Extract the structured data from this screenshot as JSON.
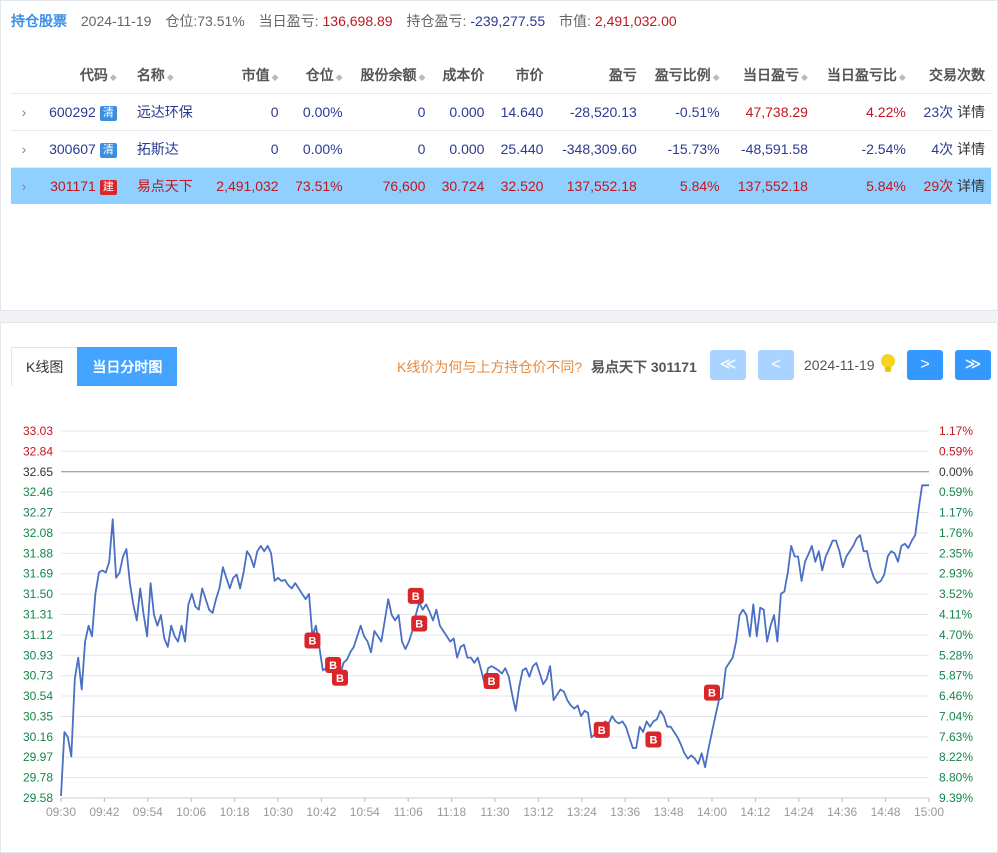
{
  "summary": {
    "title": "持仓股票",
    "date": "2024-11-19",
    "position_label": "仓位:",
    "position_value": "73.51%",
    "day_pnl_label": "当日盈亏:",
    "day_pnl_value": "136,698.89",
    "hold_pnl_label": "持仓盈亏:",
    "hold_pnl_value": "-239,277.55",
    "market_value_label": "市值:",
    "market_value_value": "2,491,032.00"
  },
  "table": {
    "headers": [
      "代码",
      "名称",
      "市值",
      "仓位",
      "股份余额",
      "成本价",
      "市价",
      "盈亏",
      "盈亏比例",
      "当日盈亏",
      "当日盈亏比",
      "交易次数"
    ],
    "sortable": [
      true,
      true,
      true,
      true,
      true,
      false,
      false,
      false,
      true,
      true,
      true,
      false
    ],
    "rows": [
      {
        "expand": "›",
        "code": "600292",
        "tag": "清",
        "tag_type": "qing",
        "name": "远达环保",
        "market_value": "0",
        "position": "0.00%",
        "shares": "0",
        "cost": "0.000",
        "price": "14.640",
        "pnl": "-28,520.13",
        "pnl_ratio": "-0.51%",
        "day_pnl": "47,738.29",
        "day_pnl_ratio": "4.22%",
        "trades": "23次",
        "detail": "详情",
        "highlight": false
      },
      {
        "expand": "›",
        "code": "300607",
        "tag": "清",
        "tag_type": "qing",
        "name": "拓斯达",
        "market_value": "0",
        "position": "0.00%",
        "shares": "0",
        "cost": "0.000",
        "price": "25.440",
        "pnl": "-348,309.60",
        "pnl_ratio": "-15.73%",
        "day_pnl": "-48,591.58",
        "day_pnl_ratio": "-2.54%",
        "trades": "4次",
        "detail": "详情",
        "highlight": false
      },
      {
        "expand": "›",
        "code": "301171",
        "tag": "建",
        "tag_type": "jian",
        "name": "易点天下",
        "market_value": "2,491,032",
        "position": "73.51%",
        "shares": "76,600",
        "cost": "30.724",
        "price": "32.520",
        "pnl": "137,552.18",
        "pnl_ratio": "5.84%",
        "day_pnl": "137,552.18",
        "day_pnl_ratio": "5.84%",
        "trades": "29次",
        "detail": "详情",
        "highlight": true
      }
    ]
  },
  "chart_panel": {
    "tabs": [
      "K线图",
      "当日分时图"
    ],
    "active_tab": 1,
    "hint": "K线价为何与上方持仓价不同?",
    "stock": "易点天下 301171",
    "date": "2024-11-19",
    "nav_first": "≪",
    "nav_prev": "<",
    "nav_next": ">",
    "nav_last": "≫"
  },
  "colors": {
    "line": "#4a6fc4",
    "up": "#c0171f",
    "down": "#13864a",
    "accent": "#44a3ff",
    "buy_marker": "#d9262b"
  },
  "chart_data": {
    "type": "line",
    "prev_close": 32.65,
    "y_ticks_price": [
      "33.03",
      "32.84",
      "32.65",
      "32.46",
      "32.27",
      "32.08",
      "31.88",
      "31.69",
      "31.50",
      "31.31",
      "31.12",
      "30.93",
      "30.73",
      "30.54",
      "30.35",
      "30.16",
      "29.97",
      "29.78",
      "29.58"
    ],
    "y_ticks_pct": [
      "1.17%",
      "0.59%",
      "0.00%",
      "0.59%",
      "1.17%",
      "1.76%",
      "2.35%",
      "2.93%",
      "3.52%",
      "4.11%",
      "4.70%",
      "5.28%",
      "5.87%",
      "6.46%",
      "7.04%",
      "7.63%",
      "8.22%",
      "8.80%",
      "9.39%"
    ],
    "ylim": [
      29.58,
      33.03
    ],
    "x_ticks": [
      "09:30",
      "09:42",
      "09:54",
      "10:06",
      "10:18",
      "10:30",
      "10:42",
      "10:54",
      "11:06",
      "11:18",
      "11:30",
      "13:12",
      "13:24",
      "13:36",
      "13:48",
      "14:00",
      "14:12",
      "14:24",
      "14:36",
      "14:48",
      "15:00"
    ],
    "series": [
      {
        "points": [
          [
            0,
            29.6
          ],
          [
            1,
            30.2
          ],
          [
            2,
            30.15
          ],
          [
            3,
            29.97
          ],
          [
            4,
            30.7
          ],
          [
            5,
            30.9
          ],
          [
            6,
            30.6
          ],
          [
            7,
            31.05
          ],
          [
            8,
            31.2
          ],
          [
            9,
            31.1
          ],
          [
            10,
            31.5
          ],
          [
            11,
            31.7
          ],
          [
            12,
            31.72
          ],
          [
            13,
            31.7
          ],
          [
            14,
            31.8
          ],
          [
            15,
            32.2
          ],
          [
            16,
            31.65
          ],
          [
            17,
            31.7
          ],
          [
            18,
            31.85
          ],
          [
            19,
            31.92
          ],
          [
            20,
            31.6
          ],
          [
            21,
            31.4
          ],
          [
            22,
            31.25
          ],
          [
            23,
            31.55
          ],
          [
            24,
            31.3
          ],
          [
            25,
            31.1
          ],
          [
            26,
            31.6
          ],
          [
            27,
            31.3
          ],
          [
            28,
            31.2
          ],
          [
            29,
            31.3
          ],
          [
            30,
            31.08
          ],
          [
            31,
            31.0
          ],
          [
            32,
            31.2
          ],
          [
            33,
            31.1
          ],
          [
            34,
            31.05
          ],
          [
            35,
            31.2
          ],
          [
            36,
            31.05
          ],
          [
            37,
            31.4
          ],
          [
            38,
            31.5
          ],
          [
            39,
            31.38
          ],
          [
            40,
            31.35
          ],
          [
            41,
            31.55
          ],
          [
            42,
            31.45
          ],
          [
            43,
            31.35
          ],
          [
            44,
            31.32
          ],
          [
            45,
            31.45
          ],
          [
            46,
            31.55
          ],
          [
            47,
            31.75
          ],
          [
            48,
            31.65
          ],
          [
            49,
            31.55
          ],
          [
            50,
            31.65
          ],
          [
            51,
            31.68
          ],
          [
            52,
            31.55
          ],
          [
            53,
            31.7
          ],
          [
            54,
            31.9
          ],
          [
            55,
            31.85
          ],
          [
            56,
            31.75
          ],
          [
            57,
            31.9
          ],
          [
            58,
            31.95
          ],
          [
            59,
            31.9
          ],
          [
            60,
            31.95
          ],
          [
            61,
            31.88
          ],
          [
            62,
            31.62
          ],
          [
            63,
            31.65
          ],
          [
            64,
            31.62
          ],
          [
            65,
            31.63
          ],
          [
            66,
            31.58
          ],
          [
            67,
            31.55
          ],
          [
            68,
            31.6
          ],
          [
            69,
            31.55
          ],
          [
            70,
            31.5
          ],
          [
            71,
            31.45
          ],
          [
            72,
            31.5
          ],
          [
            73,
            31.1
          ],
          [
            74,
            31.2
          ],
          [
            75,
            31.0
          ],
          [
            76,
            30.78
          ],
          [
            77,
            30.8
          ],
          [
            78,
            30.9
          ],
          [
            79,
            30.75
          ],
          [
            80,
            30.78
          ],
          [
            81,
            30.72
          ],
          [
            82,
            30.85
          ],
          [
            83,
            30.88
          ],
          [
            84,
            30.95
          ],
          [
            85,
            31.0
          ],
          [
            86,
            31.1
          ],
          [
            87,
            31.2
          ],
          [
            88,
            31.1
          ],
          [
            89,
            31.05
          ],
          [
            90,
            30.95
          ],
          [
            91,
            31.15
          ],
          [
            92,
            31.1
          ],
          [
            93,
            31.05
          ],
          [
            94,
            31.25
          ],
          [
            95,
            31.45
          ],
          [
            96,
            31.3
          ],
          [
            97,
            31.25
          ],
          [
            98,
            31.3
          ],
          [
            99,
            31.05
          ],
          [
            100,
            30.98
          ],
          [
            101,
            31.05
          ],
          [
            102,
            31.15
          ],
          [
            103,
            31.3
          ],
          [
            104,
            31.42
          ],
          [
            105,
            31.35
          ],
          [
            106,
            31.4
          ],
          [
            107,
            31.33
          ],
          [
            108,
            31.25
          ],
          [
            109,
            31.35
          ],
          [
            110,
            31.2
          ],
          [
            111,
            31.15
          ],
          [
            112,
            31.1
          ],
          [
            113,
            31.05
          ],
          [
            114,
            31.08
          ],
          [
            115,
            30.9
          ],
          [
            116,
            31.0
          ],
          [
            117,
            31.02
          ],
          [
            118,
            30.9
          ],
          [
            119,
            30.9
          ],
          [
            120,
            30.85
          ],
          [
            121,
            30.9
          ],
          [
            122,
            30.78
          ],
          [
            123,
            30.65
          ],
          [
            124,
            30.8
          ],
          [
            125,
            30.82
          ],
          [
            126,
            30.8
          ],
          [
            127,
            30.78
          ],
          [
            128,
            30.75
          ],
          [
            129,
            30.8
          ],
          [
            130,
            30.72
          ],
          [
            131,
            30.55
          ],
          [
            132,
            30.4
          ],
          [
            133,
            30.62
          ],
          [
            134,
            30.78
          ],
          [
            135,
            30.8
          ],
          [
            136,
            30.72
          ],
          [
            137,
            30.82
          ],
          [
            138,
            30.85
          ],
          [
            139,
            30.75
          ],
          [
            140,
            30.65
          ],
          [
            141,
            30.7
          ],
          [
            142,
            30.82
          ],
          [
            143,
            30.5
          ],
          [
            144,
            30.55
          ],
          [
            145,
            30.6
          ],
          [
            146,
            30.58
          ],
          [
            147,
            30.5
          ],
          [
            148,
            30.45
          ],
          [
            149,
            30.42
          ],
          [
            150,
            30.45
          ],
          [
            151,
            30.35
          ],
          [
            152,
            30.4
          ],
          [
            153,
            30.38
          ],
          [
            154,
            30.15
          ],
          [
            155,
            30.18
          ],
          [
            156,
            30.25
          ],
          [
            157,
            30.25
          ],
          [
            158,
            30.3
          ],
          [
            159,
            30.28
          ],
          [
            160,
            30.35
          ],
          [
            161,
            30.3
          ],
          [
            162,
            30.28
          ],
          [
            163,
            30.3
          ],
          [
            164,
            30.25
          ],
          [
            165,
            30.15
          ],
          [
            166,
            30.05
          ],
          [
            167,
            30.05
          ],
          [
            168,
            30.25
          ],
          [
            169,
            30.2
          ],
          [
            170,
            30.3
          ],
          [
            171,
            30.25
          ],
          [
            172,
            30.3
          ],
          [
            173,
            30.32
          ],
          [
            174,
            30.4
          ],
          [
            175,
            30.35
          ],
          [
            176,
            30.25
          ],
          [
            177,
            30.25
          ],
          [
            178,
            30.2
          ],
          [
            179,
            30.15
          ],
          [
            180,
            30.08
          ],
          [
            181,
            30.0
          ],
          [
            182,
            29.95
          ],
          [
            183,
            29.98
          ],
          [
            184,
            29.95
          ],
          [
            185,
            29.9
          ],
          [
            186,
            30.0
          ],
          [
            187,
            29.87
          ],
          [
            188,
            30.05
          ],
          [
            189,
            30.2
          ],
          [
            190,
            30.35
          ],
          [
            191,
            30.5
          ],
          [
            192,
            30.52
          ],
          [
            193,
            30.8
          ],
          [
            194,
            30.85
          ],
          [
            195,
            30.9
          ],
          [
            196,
            31.05
          ],
          [
            197,
            31.3
          ],
          [
            198,
            31.35
          ],
          [
            199,
            31.3
          ],
          [
            200,
            31.1
          ],
          [
            201,
            31.4
          ],
          [
            202,
            31.1
          ],
          [
            203,
            31.37
          ],
          [
            204,
            31.35
          ],
          [
            205,
            31.05
          ],
          [
            206,
            31.2
          ],
          [
            207,
            31.3
          ],
          [
            208,
            31.05
          ],
          [
            209,
            31.5
          ],
          [
            210,
            31.52
          ],
          [
            211,
            31.7
          ],
          [
            212,
            31.95
          ],
          [
            213,
            31.85
          ],
          [
            214,
            31.85
          ],
          [
            215,
            31.62
          ],
          [
            216,
            31.8
          ],
          [
            217,
            31.87
          ],
          [
            218,
            31.95
          ],
          [
            219,
            31.8
          ],
          [
            220,
            31.9
          ],
          [
            221,
            31.72
          ],
          [
            222,
            31.85
          ],
          [
            223,
            31.92
          ],
          [
            224,
            32.0
          ],
          [
            225,
            32.0
          ],
          [
            226,
            31.9
          ],
          [
            227,
            31.75
          ],
          [
            228,
            31.85
          ],
          [
            229,
            31.9
          ],
          [
            230,
            31.95
          ],
          [
            231,
            32.02
          ],
          [
            232,
            32.05
          ],
          [
            233,
            31.9
          ],
          [
            234,
            31.9
          ],
          [
            235,
            31.75
          ],
          [
            236,
            31.65
          ],
          [
            237,
            31.6
          ],
          [
            238,
            31.62
          ],
          [
            239,
            31.68
          ],
          [
            240,
            31.85
          ],
          [
            241,
            31.9
          ],
          [
            242,
            31.88
          ],
          [
            243,
            31.8
          ],
          [
            244,
            31.95
          ],
          [
            245,
            31.97
          ],
          [
            246,
            31.93
          ],
          [
            247,
            32.0
          ],
          [
            248,
            32.05
          ],
          [
            249,
            32.3
          ],
          [
            250,
            32.52
          ],
          [
            251,
            32.52
          ],
          [
            252,
            32.52
          ]
        ]
      }
    ],
    "buy_markers": [
      {
        "t": 73,
        "price": 31.06,
        "label": "B"
      },
      {
        "t": 79,
        "price": 30.83,
        "label": "B"
      },
      {
        "t": 81,
        "price": 30.71,
        "label": "B"
      },
      {
        "t": 103,
        "price": 31.48,
        "label": "B"
      },
      {
        "t": 104,
        "price": 31.22,
        "label": "B"
      },
      {
        "t": 125,
        "price": 30.68,
        "label": "B"
      },
      {
        "t": 157,
        "price": 30.22,
        "label": "B"
      },
      {
        "t": 172,
        "price": 30.13,
        "label": "B"
      },
      {
        "t": 189,
        "price": 30.57,
        "label": "B"
      }
    ]
  }
}
